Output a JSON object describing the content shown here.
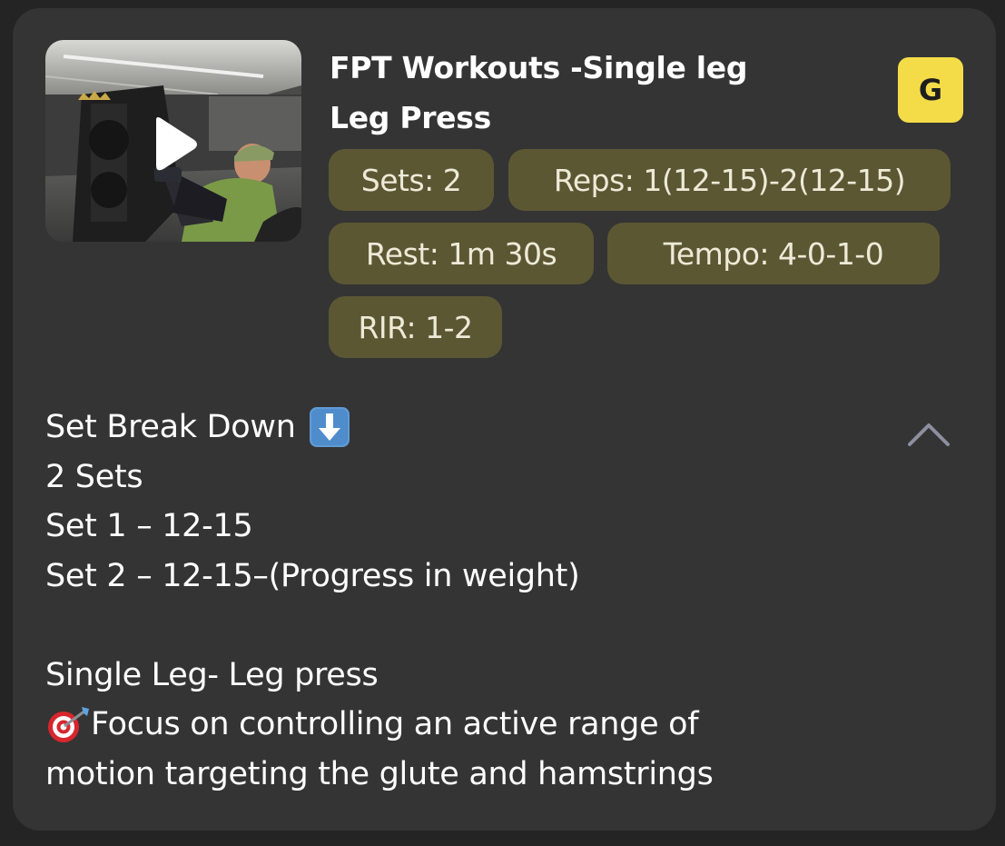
{
  "workout": {
    "title_line1": "FPT Workouts -Single leg",
    "title_line2": "Leg Press",
    "badge": "G",
    "chips": {
      "sets": "Sets: 2",
      "reps": "Reps: 1(12-15)-2(12-15)",
      "rest": "Rest: 1m 30s",
      "tempo": "Tempo: 4-0-1-0",
      "rir": "RIR: 1-2"
    }
  },
  "description": {
    "heading": "Set Break Down",
    "heading_icon": "down-arrow-emoji",
    "line1": "2 Sets",
    "line2": "Set 1 – 12-15",
    "line3": "Set 2 – 12-15–(Progress in weight)",
    "line4": "Single Leg- Leg press",
    "focus_icon": "target-emoji",
    "line5": "Focus on controlling an active range of",
    "line6": "motion targeting the glute and hamstrings"
  },
  "colors": {
    "card_bg": "#343434",
    "chip_bg": "#5c5733",
    "badge_bg": "#f4dc48"
  }
}
